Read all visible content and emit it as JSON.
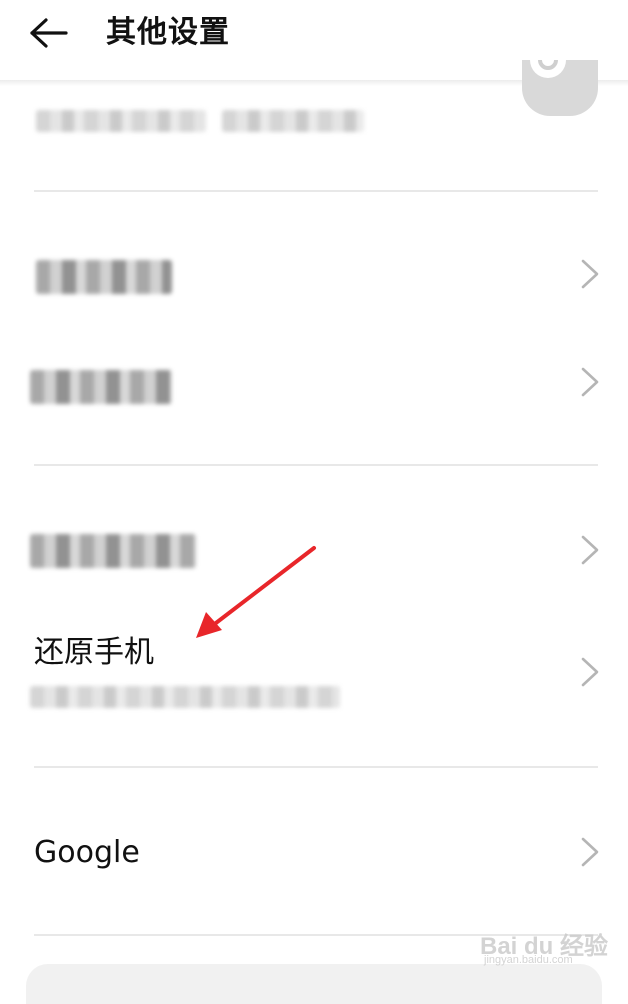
{
  "header": {
    "title": "其他设置",
    "back_icon": "arrow-left-icon"
  },
  "settings": {
    "reset_phone_label": "还原手机",
    "google_label": "Google"
  },
  "watermark": {
    "main": "Bai du 经验",
    "sub": "jingyan.baidu.com"
  },
  "annotation": {
    "arrow_color": "#e8262a"
  }
}
